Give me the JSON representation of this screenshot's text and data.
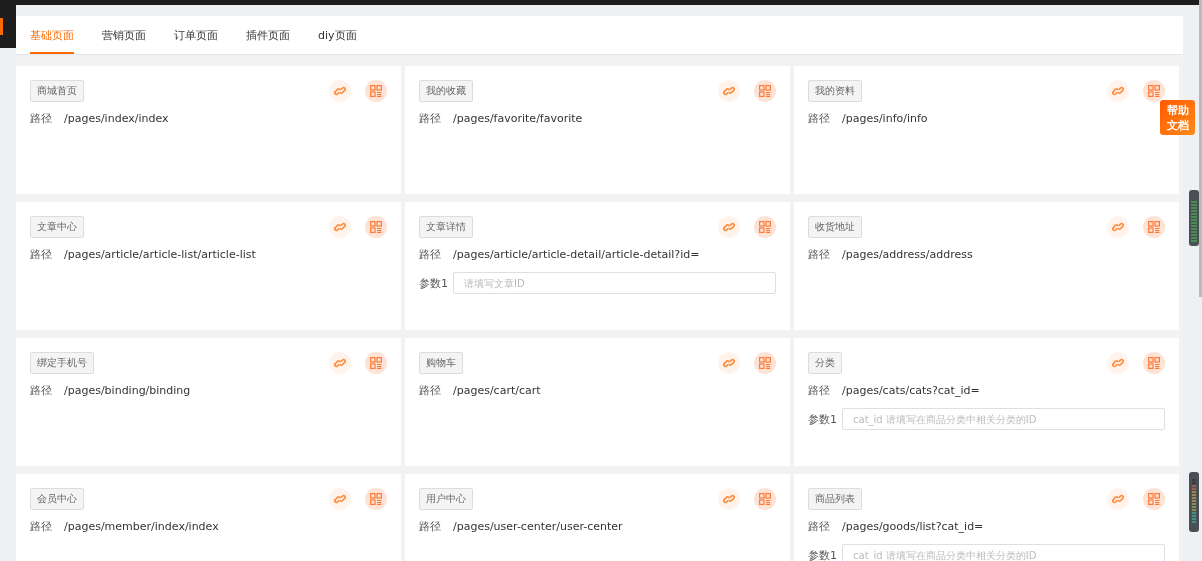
{
  "tabs": [
    {
      "label": "基础页面",
      "selected": true
    },
    {
      "label": "营销页面",
      "selected": false
    },
    {
      "label": "订单页面",
      "selected": false
    },
    {
      "label": "插件页面",
      "selected": false
    },
    {
      "label": "diy页面",
      "selected": false
    }
  ],
  "cards": [
    {
      "tag": "商城首页",
      "path_label": "路径",
      "path": "/pages/index/index"
    },
    {
      "tag": "我的收藏",
      "path_label": "路径",
      "path": "/pages/favorite/favorite"
    },
    {
      "tag": "我的资料",
      "path_label": "路径",
      "path": "/pages/info/info"
    },
    {
      "tag": "文章中心",
      "path_label": "路径",
      "path": "/pages/article/article-list/article-list"
    },
    {
      "tag": "文章详情",
      "path_label": "路径",
      "path": "/pages/article/article-detail/article-detail?id=",
      "param": {
        "label": "参数1",
        "placeholder": "请填写文章ID"
      }
    },
    {
      "tag": "收货地址",
      "path_label": "路径",
      "path": "/pages/address/address"
    },
    {
      "tag": "绑定手机号",
      "path_label": "路径",
      "path": "/pages/binding/binding"
    },
    {
      "tag": "购物车",
      "path_label": "路径",
      "path": "/pages/cart/cart"
    },
    {
      "tag": "分类",
      "path_label": "路径",
      "path": "/pages/cats/cats?cat_id=",
      "param": {
        "label": "参数1",
        "placeholder": "cat_id 请填写在商品分类中相关分类的ID"
      }
    },
    {
      "tag": "会员中心",
      "path_label": "路径",
      "path": "/pages/member/index/index"
    },
    {
      "tag": "用户中心",
      "path_label": "路径",
      "path": "/pages/user-center/user-center"
    },
    {
      "tag": "商品列表",
      "path_label": "路径",
      "path": "/pages/goods/list?cat_id=",
      "param": {
        "label": "参数1",
        "placeholder": "cat_id 请填写在商品分类中相关分类的ID"
      }
    }
  ],
  "help_button": {
    "lines": [
      "帮助",
      "文档"
    ]
  }
}
